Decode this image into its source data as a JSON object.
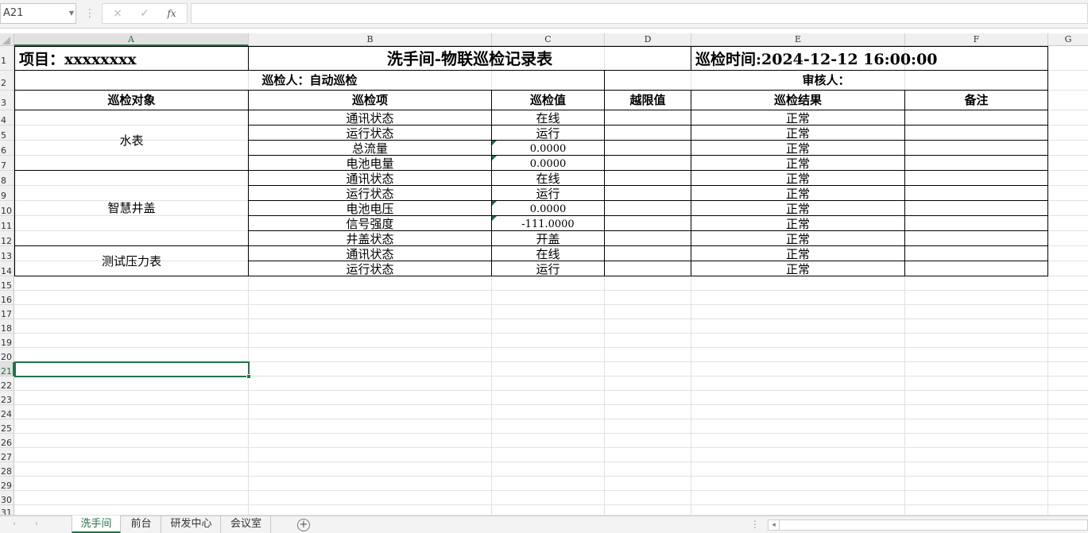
{
  "formula_bar": {
    "name_box": "A21",
    "cancel_icon": "×",
    "enter_icon": "✓",
    "function_icon": "fx",
    "formula": ""
  },
  "columns": [
    "A",
    "B",
    "C",
    "D",
    "E",
    "F",
    "G"
  ],
  "rows": [
    "1",
    "2",
    "3",
    "4",
    "5",
    "6",
    "7",
    "8",
    "9",
    "10",
    "11",
    "12",
    "13",
    "14",
    "15",
    "16",
    "17",
    "18",
    "19",
    "20",
    "21",
    "22",
    "23",
    "24",
    "25",
    "26",
    "27",
    "28",
    "29",
    "30",
    "31"
  ],
  "sheet": {
    "project": "项目：xxxxxxxx",
    "title": "洗手间-物联巡检记录表",
    "time": "巡检时间:2024-12-12  16:00:00",
    "inspector": "巡检人：自动巡检",
    "reviewer": "审核人：",
    "headers": [
      "巡检对象",
      "巡检项",
      "巡检值",
      "越限值",
      "巡检结果",
      "备注"
    ],
    "groups": [
      {
        "object": "水表",
        "items": [
          {
            "item": "通讯状态",
            "value": "在线",
            "limit": "",
            "result": "正常",
            "note": ""
          },
          {
            "item": "运行状态",
            "value": "运行",
            "limit": "",
            "result": "正常",
            "note": ""
          },
          {
            "item": "总流量",
            "value": "0.0000",
            "limit": "",
            "result": "正常",
            "note": ""
          },
          {
            "item": "电池电量",
            "value": "0.0000",
            "limit": "",
            "result": "正常",
            "note": ""
          }
        ]
      },
      {
        "object": "智慧井盖",
        "items": [
          {
            "item": "通讯状态",
            "value": "在线",
            "limit": "",
            "result": "正常",
            "note": ""
          },
          {
            "item": "运行状态",
            "value": "运行",
            "limit": "",
            "result": "正常",
            "note": ""
          },
          {
            "item": "电池电压",
            "value": "0.0000",
            "limit": "",
            "result": "正常",
            "note": ""
          },
          {
            "item": "信号强度",
            "value": "-111.0000",
            "limit": "",
            "result": "正常",
            "note": ""
          },
          {
            "item": "井盖状态",
            "value": "开盖",
            "limit": "",
            "result": "正常",
            "note": ""
          }
        ]
      },
      {
        "object": "测试压力表",
        "items": [
          {
            "item": "通讯状态",
            "value": "在线",
            "limit": "",
            "result": "正常",
            "note": ""
          },
          {
            "item": "运行状态",
            "value": "运行",
            "limit": "",
            "result": "正常",
            "note": ""
          }
        ]
      }
    ]
  },
  "tabs": [
    "洗手间",
    "前台",
    "研发中心",
    "会议室"
  ],
  "tab_nav": {
    "prev": "‹",
    "next": "›",
    "add": "+",
    "more": "⋮",
    "scroll_left": "◂"
  },
  "colors": {
    "accent": "#217346",
    "error_indicator": "#1e7145"
  }
}
